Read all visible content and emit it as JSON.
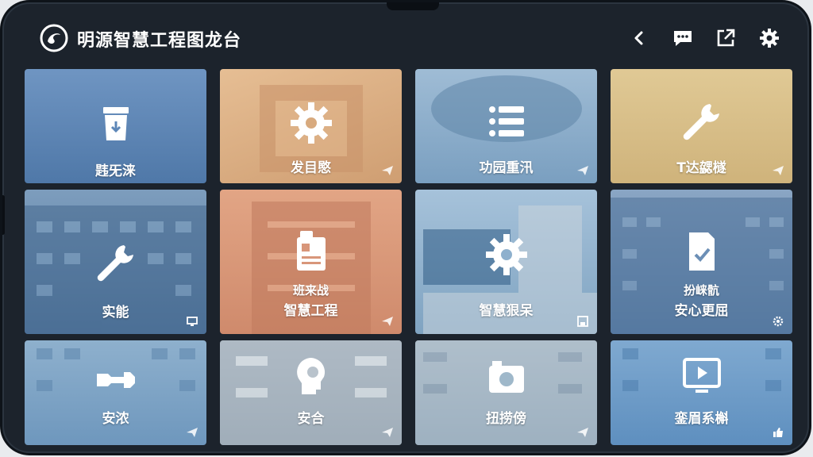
{
  "header": {
    "app_title": "明源智慧工程图龙台",
    "icons": [
      "logo-icon",
      "back-icon",
      "message-icon",
      "share-icon",
      "settings-icon"
    ]
  },
  "tiles": [
    {
      "label": "韪旡涞",
      "icon": "clipboard-icon",
      "corner": "",
      "color": "#5d87b8"
    },
    {
      "label": "发目愍",
      "icon": "gear-icon",
      "corner": "plane-icon",
      "color": "#d8aa7e"
    },
    {
      "label": "功园重汛",
      "icon": "list-icon",
      "corner": "plane-icon",
      "color": "#83a8c8"
    },
    {
      "label": "T达勰檖",
      "icon": "wrench-icon",
      "corner": "plane-icon",
      "color": "#d9c08a"
    },
    {
      "label": "实能",
      "icon": "wrench-icon",
      "corner": "monitor-icon",
      "color": "#5f86ad"
    },
    {
      "sub": "班来战",
      "label": "智慧工程",
      "icon": "id-badge-icon",
      "corner": "plane-icon",
      "color": "#d8967a"
    },
    {
      "label": "智慧狠呆",
      "icon": "gear-icon",
      "corner": "save-icon",
      "color": "#8eb0cd"
    },
    {
      "sub": "扮崃骯",
      "label": "安心更屈",
      "icon": "document-check-icon",
      "corner": "gear-icon",
      "color": "#6c8fb6"
    },
    {
      "label": "安浓",
      "icon": "wrench-icon",
      "corner": "plane-icon",
      "color": "#7ca3c5"
    },
    {
      "label": "安合",
      "icon": "head-gear-icon",
      "corner": "plane-icon",
      "color": "#b9c3cc"
    },
    {
      "label": "扭捞傍",
      "icon": "camera-icon",
      "corner": "plane-icon",
      "color": "#9fb8ca"
    },
    {
      "label": "銮眉系槲",
      "icon": "play-monitor-icon",
      "corner": "thumb-icon",
      "color": "#6f9dc8"
    }
  ]
}
